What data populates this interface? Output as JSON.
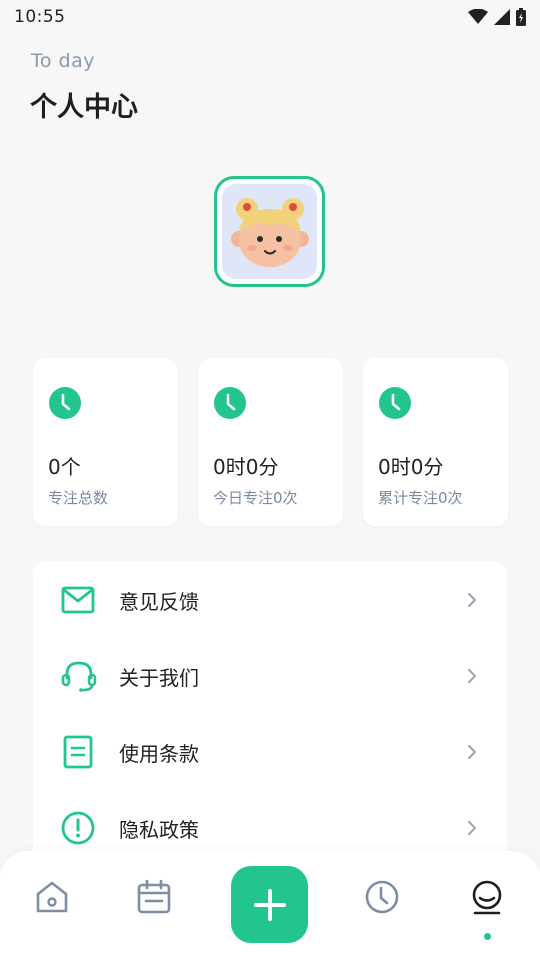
{
  "status_bar": {
    "time": "10:55"
  },
  "header": {
    "subtitle": "To day",
    "title": "个人中心"
  },
  "stats": [
    {
      "value": "0个",
      "label": "专注总数"
    },
    {
      "value": "0时0分",
      "label": "今日专注0次"
    },
    {
      "value": "0时0分",
      "label": "累计专注0次"
    }
  ],
  "menu": [
    {
      "label": "意见反馈",
      "icon": "mail-icon"
    },
    {
      "label": "关于我们",
      "icon": "headset-icon"
    },
    {
      "label": "使用条款",
      "icon": "document-icon"
    },
    {
      "label": "隐私政策",
      "icon": "alert-circle-icon"
    }
  ],
  "bottom_nav": [
    {
      "icon": "home-icon",
      "active": false
    },
    {
      "icon": "calendar-icon",
      "active": false
    },
    {
      "icon": "plus-icon",
      "active": false
    },
    {
      "icon": "clock-icon",
      "active": false
    },
    {
      "icon": "profile-icon",
      "active": true
    }
  ],
  "colors": {
    "accent": "#22c58b",
    "muted": "#7a8aa0",
    "background": "#f7f7f7"
  }
}
